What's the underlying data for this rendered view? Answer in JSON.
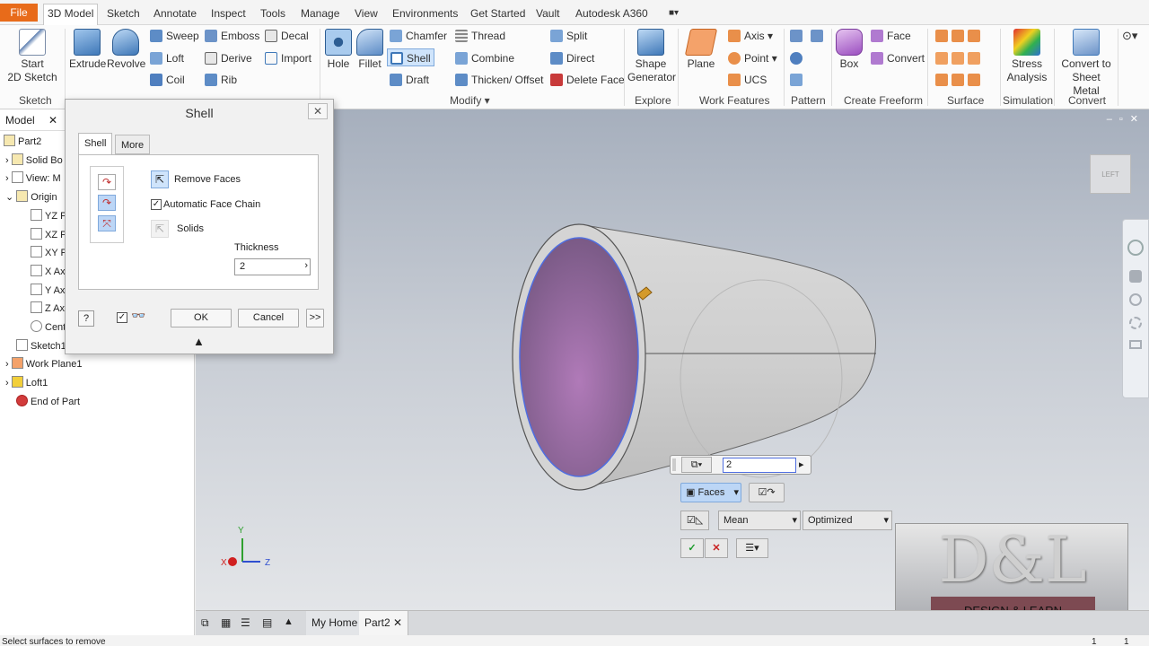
{
  "menu": {
    "tabs": [
      "File",
      "3D Model",
      "Sketch",
      "Annotate",
      "Inspect",
      "Tools",
      "Manage",
      "View",
      "Environments",
      "Get Started",
      "Vault",
      "Autodesk A360"
    ]
  },
  "ribbon": {
    "sketch": {
      "start_line1": "Start",
      "start_line2": "2D Sketch",
      "group": "Sketch"
    },
    "create": {
      "extrude": "Extrude",
      "revolve": "Revolve",
      "sweep": "Sweep",
      "loft": "Loft",
      "coil": "Coil",
      "emboss": "Emboss",
      "derive": "Derive",
      "rib": "Rib",
      "decal": "Decal",
      "import": "Import"
    },
    "modify": {
      "hole": "Hole",
      "fillet": "Fillet",
      "chamfer": "Chamfer",
      "shell": "Shell",
      "draft": "Draft",
      "thread": "Thread",
      "combine": "Combine",
      "thicken": "Thicken/ Offset",
      "split": "Split",
      "direct": "Direct",
      "delete_face": "Delete Face",
      "group": "Modify"
    },
    "explore": {
      "shape_line1": "Shape",
      "shape_line2": "Generator",
      "group": "Explore"
    },
    "work": {
      "plane": "Plane",
      "axis": "Axis",
      "point": "Point",
      "ucs": "UCS",
      "group": "Work Features"
    },
    "pattern": {
      "group": "Pattern"
    },
    "freeform": {
      "box": "Box",
      "face": "Face",
      "convert": "Convert",
      "group": "Create Freeform"
    },
    "surface": {
      "group": "Surface"
    },
    "simulation": {
      "line1": "Stress",
      "line2": "Analysis",
      "group": "Simulation"
    },
    "convert": {
      "line1": "Convert to",
      "line2": "Sheet Metal",
      "group": "Convert"
    }
  },
  "browser": {
    "tab": "Model",
    "nodes": [
      "Part2",
      "Solid Bo",
      "View: M",
      "Origin",
      "YZ P",
      "XZ P",
      "XY P",
      "X Ax",
      "Y Ax",
      "Z Ax",
      "Cent",
      "Sketch1",
      "Work Plane1",
      "Loft1",
      "End of Part"
    ]
  },
  "dialog": {
    "title": "Shell",
    "tab_shell": "Shell",
    "tab_more": "More",
    "remove_faces": "Remove Faces",
    "auto_chain": "Automatic Face Chain",
    "solids": "Solids",
    "thickness_label": "Thickness",
    "thickness_value": "2",
    "ok": "OK",
    "cancel": "Cancel",
    "expand": ">>"
  },
  "minitoolbar": {
    "value": "2",
    "faces": "Faces",
    "mean": "Mean",
    "optimized": "Optimized"
  },
  "doctabs": {
    "home": "My Home",
    "part": "Part2"
  },
  "watermark": {
    "logo": "D&L",
    "tagline": "DESIGN & LEARN"
  },
  "viewcube": {
    "label": "LEFT"
  },
  "triad": {
    "x": "X",
    "y": "Y",
    "z": "Z"
  },
  "status": {
    "prompt": "Select surfaces to remove",
    "n1": "1",
    "n2": "1"
  }
}
